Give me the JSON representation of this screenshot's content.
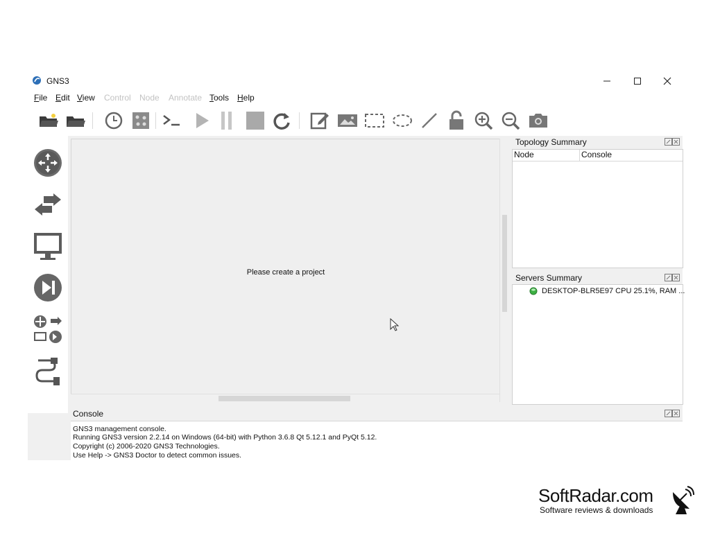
{
  "window": {
    "title": "GNS3",
    "controls": [
      "minimize-icon",
      "maximize-icon",
      "close-icon"
    ]
  },
  "menu": [
    {
      "label": "File",
      "enabled": true
    },
    {
      "label": "Edit",
      "enabled": true
    },
    {
      "label": "View",
      "enabled": true
    },
    {
      "label": "Control",
      "enabled": false
    },
    {
      "label": "Node",
      "enabled": false
    },
    {
      "label": "Annotate",
      "enabled": false
    },
    {
      "label": "Tools",
      "enabled": true
    },
    {
      "label": "Help",
      "enabled": true
    }
  ],
  "toolbar_icons": [
    "open-folder-icon",
    "open-project-icon",
    "snapshot-clock-icon",
    "topology-grid-icon",
    "console-icon",
    "start-icon",
    "pause-icon",
    "stop-icon",
    "reload-icon",
    "add-note-icon",
    "insert-image-icon",
    "draw-rectangle-icon",
    "draw-ellipse-icon",
    "draw-line-icon",
    "lock-icon",
    "zoom-in-icon",
    "zoom-out-icon",
    "screenshot-icon"
  ],
  "device_icons": [
    "router-icon",
    "switch-icon",
    "end-device-icon",
    "security-device-icon",
    "all-devices-icon",
    "add-link-icon"
  ],
  "canvas": {
    "message": "Please create a project"
  },
  "topology_summary": {
    "title": "Topology Summary",
    "columns": [
      "Node",
      "Console"
    ]
  },
  "servers_summary": {
    "title": "Servers Summary",
    "server": "DESKTOP-BLR5E97 CPU 25.1%, RAM ...",
    "status_color": "#3cb043"
  },
  "console": {
    "title": "Console",
    "lines": [
      "GNS3 management console.",
      "Running GNS3 version 2.2.14 on Windows (64-bit) with Python 3.6.8 Qt 5.12.1 and PyQt 5.12.",
      "Copyright (c) 2006-2020 GNS3 Technologies.",
      "Use Help -> GNS3 Doctor to detect common issues."
    ]
  },
  "watermark": {
    "brand": "SoftRadar.com",
    "tagline": "Software reviews & downloads"
  }
}
